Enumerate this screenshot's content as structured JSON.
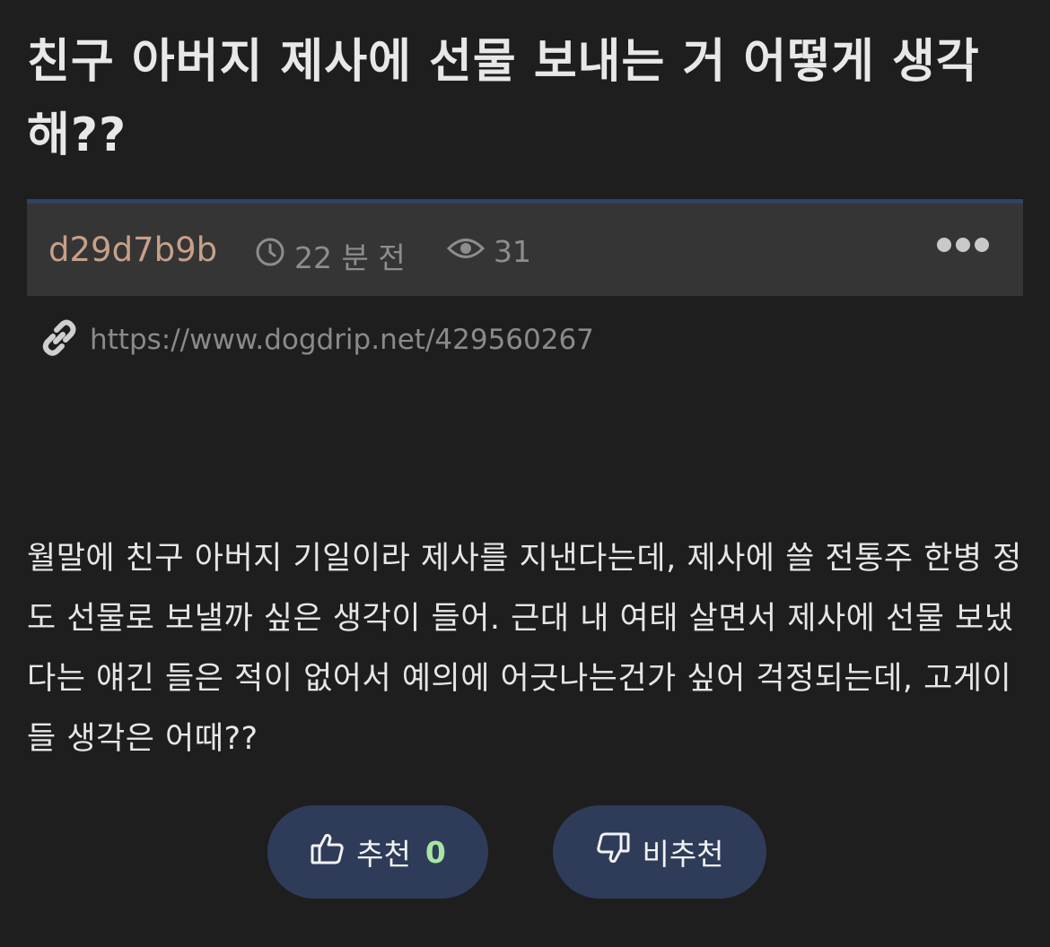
{
  "post": {
    "title": "친구 아버지 제사에 선물 보내는 거 어떻게 생각해??",
    "author": "d29d7b9b",
    "time": "22 분 전",
    "views": "31",
    "link": "https://www.dogdrip.net/429560267",
    "body": "월말에 친구 아버지 기일이라 제사를 지낸다는데, 제사에 쓸 전통주 한병 정도 선물로 보낼까 싶은 생각이 들어. 근대 내 여태 살면서 제사에 선물 보냈다는 얘긴 들은 적이 없어서 예의에 어긋나는건가 싶어 걱정되는데, 고게이들 생각은 어때??"
  },
  "votes": {
    "up_label": "추천",
    "up_count": "0",
    "down_label": "비추천"
  },
  "icons": {
    "time": "clock-icon",
    "views": "eye-icon",
    "more": "more-dots-icon",
    "link": "link-icon",
    "upvote": "thumbs-up-icon",
    "downvote": "thumbs-down-icon"
  },
  "colors": {
    "background": "#1e1e1e",
    "meta_bar": "#353535",
    "meta_bar_border": "#2f4363",
    "author": "#c7a088",
    "button": "#2e3c5a",
    "vote_count": "#a8e6a0"
  }
}
